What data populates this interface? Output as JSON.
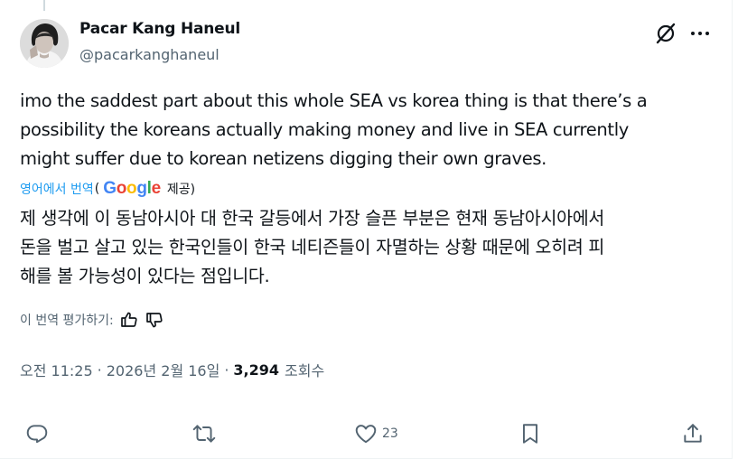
{
  "author": {
    "display_name": "Pacar Kang Haneul",
    "handle": "@pacarkanghaneul"
  },
  "tweet": {
    "text": "imo the saddest part about this whole SEA vs korea thing is that there’s a\npossibility the koreans actually making money and live in SEA currently\nmight suffer due to korean netizens digging their own graves."
  },
  "translation": {
    "link_label": "영어에서 번역",
    "open_paren": "(",
    "provider": "Google",
    "provided_label": "제공)",
    "text": "제 생각에 이 동남아시아 대 한국 갈등에서 가장 슬픈 부분은 현재 동남아시아에서\n돈을 벌고 살고 있는 한국인들이 한국 네티즌들이 자멸하는 상황 때문에 오히려 피\n해를 볼 가능성이 있다는 점입니다.",
    "rate_label": "이 번역 평가하기:"
  },
  "meta": {
    "time": "오전 11:25",
    "date": "2026년 2월 16일",
    "separator": "·",
    "views_count": "3,294",
    "views_label": "조회수"
  },
  "actions": {
    "likes_count": "23"
  },
  "colors": {
    "text": "#0f1419",
    "secondary": "#536471",
    "link": "#1d9bf0"
  }
}
